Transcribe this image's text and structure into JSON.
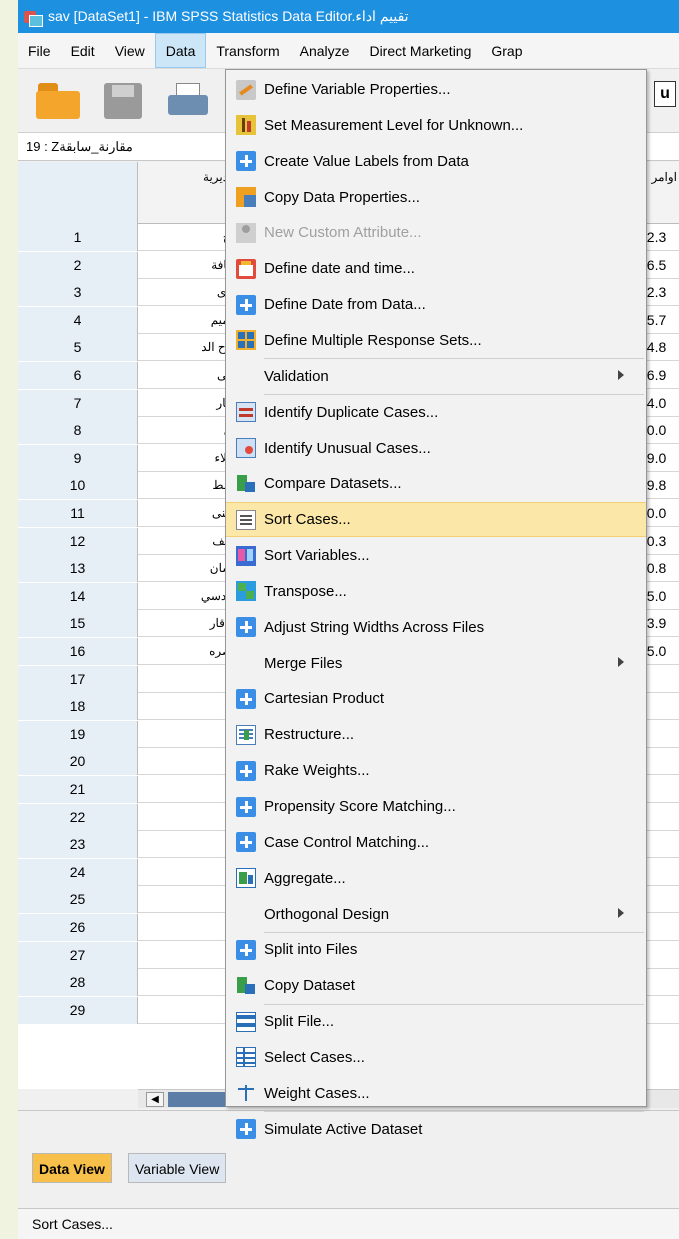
{
  "window": {
    "title": "sav [DataSet1] - IBM SPSS Statistics Data Editor.تقييم اداء"
  },
  "menubar": [
    "File",
    "Edit",
    "View",
    "Data",
    "Transform",
    "Analyze",
    "Direct Marketing",
    "Grap"
  ],
  "active_menu": "Data",
  "cell_reference": "19 : Zمقارنة_سابقة",
  "grid": {
    "col1_header": "المديرية",
    "col2_header": "اوامر",
    "rows": [
      {
        "n": "1",
        "c1": "كرخ",
        "c2": "92.3"
      },
      {
        "n": "2",
        "c1": "رصافة",
        "c2": "96.5"
      },
      {
        "n": "3",
        "c1": "نينوى",
        "c2": "32.3"
      },
      {
        "n": "4",
        "c1": "التاميم",
        "c2": "15.7"
      },
      {
        "n": "5",
        "c1": "صلاح الد",
        "c2": "64.8"
      },
      {
        "n": "6",
        "c1": "ديالى",
        "c2": "36.9"
      },
      {
        "n": "7",
        "c1": "الانبار",
        "c2": "44.0"
      },
      {
        "n": "8",
        "c1": "بابل",
        "c2": "50.0"
      },
      {
        "n": "9",
        "c1": "كربلاء",
        "c2": "59.0"
      },
      {
        "n": "10",
        "c1": "واسط",
        "c2": "69.8"
      },
      {
        "n": "11",
        "c1": "المثنى",
        "c2": "90.0"
      },
      {
        "n": "12",
        "c1": "النجف",
        "c2": "80.3"
      },
      {
        "n": "13",
        "c1": "ميسان",
        "c2": "70.8"
      },
      {
        "n": "14",
        "c1": "القادسي",
        "c2": "25.0"
      },
      {
        "n": "15",
        "c1": "ذي قار",
        "c2": "23.9"
      },
      {
        "n": "16",
        "c1": "البصره",
        "c2": "75.0"
      },
      {
        "n": "17",
        "c1": "",
        "c2": "."
      },
      {
        "n": "18",
        "c1": "",
        "c2": "."
      },
      {
        "n": "19",
        "c1": "",
        "c2": "."
      },
      {
        "n": "20",
        "c1": "",
        "c2": "."
      },
      {
        "n": "21",
        "c1": "",
        "c2": "."
      },
      {
        "n": "22",
        "c1": "",
        "c2": "."
      },
      {
        "n": "23",
        "c1": "",
        "c2": "."
      },
      {
        "n": "24",
        "c1": "",
        "c2": "."
      },
      {
        "n": "25",
        "c1": "",
        "c2": "."
      },
      {
        "n": "26",
        "c1": "",
        "c2": "."
      },
      {
        "n": "27",
        "c1": "",
        "c2": "."
      },
      {
        "n": "28",
        "c1": "",
        "c2": "."
      },
      {
        "n": "29",
        "c1": "",
        "c2": ""
      }
    ]
  },
  "data_menu": [
    {
      "label": "Define Variable Properties...",
      "icon": "pencil-icon",
      "cls": "i-pencil"
    },
    {
      "label": "Set Measurement Level for Unknown...",
      "icon": "measure-icon",
      "cls": "i-measure"
    },
    {
      "label": "Create Value Labels from Data",
      "icon": "plus-icon",
      "cls": "i-plus"
    },
    {
      "label": "Copy Data Properties...",
      "icon": "copy-icon",
      "cls": "i-copy"
    },
    {
      "label": "New Custom Attribute...",
      "icon": "attribute-icon",
      "cls": "i-attr",
      "disabled": true
    },
    {
      "label": "Define date and time...",
      "icon": "calendar-icon",
      "cls": "i-date"
    },
    {
      "label": "Define Date from Data...",
      "icon": "plus-icon",
      "cls": "i-plus"
    },
    {
      "label": "Define Multiple Response Sets...",
      "icon": "grid-icon",
      "cls": "i-multi",
      "sep_after": true
    },
    {
      "label": "Validation",
      "submenu": true,
      "sep_after": true
    },
    {
      "label": "Identify Duplicate Cases...",
      "icon": "duplicate-icon",
      "cls": "i-dup"
    },
    {
      "label": "Identify Unusual Cases...",
      "icon": "unusual-icon",
      "cls": "i-unusual"
    },
    {
      "label": "Compare Datasets...",
      "icon": "compare-icon",
      "cls": "i-compare",
      "sep_after": true
    },
    {
      "label": "Sort Cases...",
      "icon": "sort-icon",
      "cls": "i-sort",
      "highlighted": true
    },
    {
      "label": "Sort Variables...",
      "icon": "sort-variables-icon",
      "cls": "i-sortvars"
    },
    {
      "label": "Transpose...",
      "icon": "transpose-icon",
      "cls": "i-transpose"
    },
    {
      "label": "Adjust String Widths Across Files",
      "icon": "plus-icon",
      "cls": "i-plus"
    },
    {
      "label": "Merge Files",
      "submenu": true
    },
    {
      "label": "Cartesian Product",
      "icon": "plus-icon",
      "cls": "i-plus"
    },
    {
      "label": "Restructure...",
      "icon": "restructure-icon",
      "cls": "i-restructure"
    },
    {
      "label": "Rake Weights...",
      "icon": "plus-icon",
      "cls": "i-plus"
    },
    {
      "label": "Propensity Score Matching...",
      "icon": "plus-icon",
      "cls": "i-plus"
    },
    {
      "label": "Case Control Matching...",
      "icon": "plus-icon",
      "cls": "i-plus"
    },
    {
      "label": "Aggregate...",
      "icon": "aggregate-icon",
      "cls": "i-aggregate"
    },
    {
      "label": "Orthogonal Design",
      "submenu": true,
      "sep_after": true
    },
    {
      "label": "Split into Files",
      "icon": "plus-icon",
      "cls": "i-plus"
    },
    {
      "label": "Copy Dataset",
      "icon": "compare-icon",
      "cls": "i-compare",
      "sep_after": true
    },
    {
      "label": "Split File...",
      "icon": "split-icon",
      "cls": "i-split"
    },
    {
      "label": "Select Cases...",
      "icon": "select-icon",
      "cls": "i-select"
    },
    {
      "label": "Weight Cases...",
      "icon": "scale-icon",
      "cls": "i-weight",
      "sep_after": true
    },
    {
      "label": "Simulate Active Dataset",
      "icon": "plus-icon",
      "cls": "i-plus"
    }
  ],
  "tabs": {
    "data_view": "Data View",
    "variable_view": "Variable View"
  },
  "status": "Sort Cases...",
  "colors": {
    "title_bg": "#1e90e0",
    "highlight": "#fbe7a7",
    "active_tab": "#f7c04a"
  }
}
